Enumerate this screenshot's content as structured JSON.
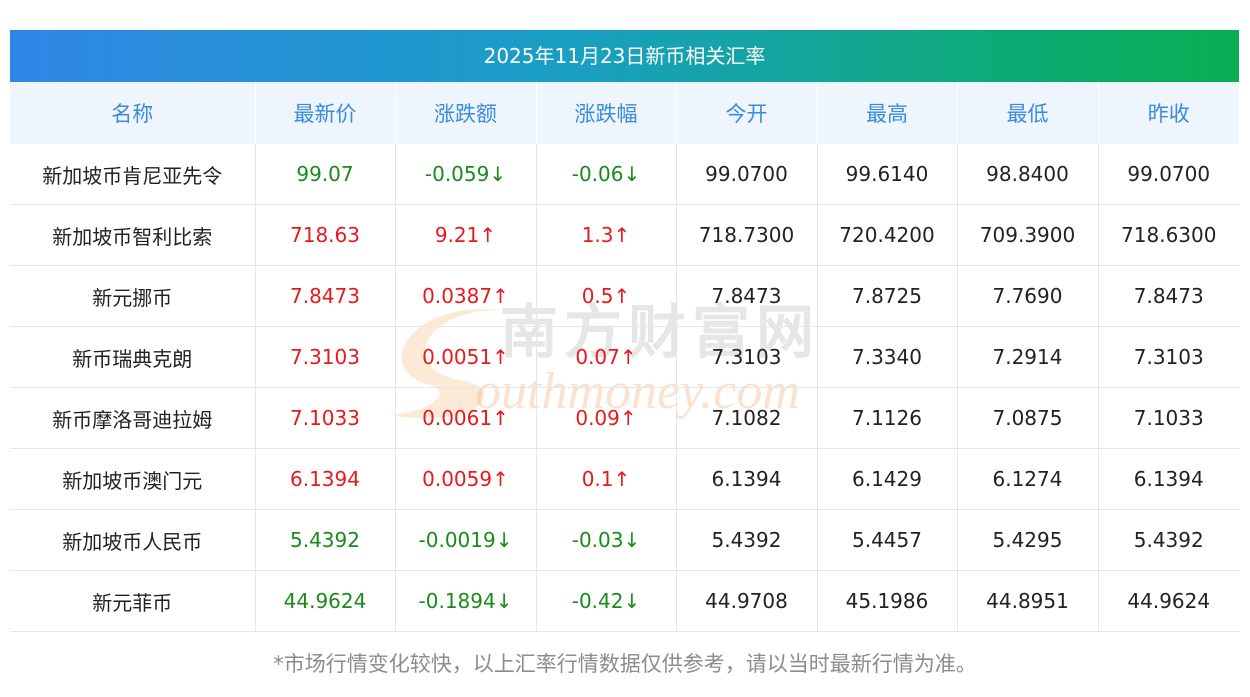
{
  "title": "2025年11月23日新币相关汇率",
  "columns": [
    "名称",
    "最新价",
    "涨跌额",
    "涨跌幅",
    "今开",
    "最高",
    "最低",
    "昨收"
  ],
  "rows": [
    {
      "name": "新加坡币肯尼亚先令",
      "latest": "99.07",
      "change": "-0.059↓",
      "change_pct": "-0.06↓",
      "open": "99.0700",
      "high": "99.6140",
      "low": "98.8400",
      "prev_close": "99.0700",
      "trend": "down"
    },
    {
      "name": "新加坡币智利比索",
      "latest": "718.63",
      "change": "9.21↑",
      "change_pct": "1.3↑",
      "open": "718.7300",
      "high": "720.4200",
      "low": "709.3900",
      "prev_close": "718.6300",
      "trend": "up"
    },
    {
      "name": "新元挪币",
      "latest": "7.8473",
      "change": "0.0387↑",
      "change_pct": "0.5↑",
      "open": "7.8473",
      "high": "7.8725",
      "low": "7.7690",
      "prev_close": "7.8473",
      "trend": "up"
    },
    {
      "name": "新币瑞典克朗",
      "latest": "7.3103",
      "change": "0.0051↑",
      "change_pct": "0.07↑",
      "open": "7.3103",
      "high": "7.3340",
      "low": "7.2914",
      "prev_close": "7.3103",
      "trend": "up"
    },
    {
      "name": "新币摩洛哥迪拉姆",
      "latest": "7.1033",
      "change": "0.0061↑",
      "change_pct": "0.09↑",
      "open": "7.1082",
      "high": "7.1126",
      "low": "7.0875",
      "prev_close": "7.1033",
      "trend": "up"
    },
    {
      "name": "新加坡币澳门元",
      "latest": "6.1394",
      "change": "0.0059↑",
      "change_pct": "0.1↑",
      "open": "6.1394",
      "high": "6.1429",
      "low": "6.1274",
      "prev_close": "6.1394",
      "trend": "up"
    },
    {
      "name": "新加坡币人民币",
      "latest": "5.4392",
      "change": "-0.0019↓",
      "change_pct": "-0.03↓",
      "open": "5.4392",
      "high": "5.4457",
      "low": "5.4295",
      "prev_close": "5.4392",
      "trend": "down"
    },
    {
      "name": "新元菲币",
      "latest": "44.9624",
      "change": "-0.1894↓",
      "change_pct": "-0.42↓",
      "open": "44.9708",
      "high": "45.1986",
      "low": "44.8951",
      "prev_close": "44.9624",
      "trend": "down"
    }
  ],
  "watermark": {
    "brand": "南方财富网",
    "domain": "outhmoney.com"
  },
  "footer_note": "*市场行情变化较快，以上汇率行情数据仅供参考，请以当时最新行情为准。",
  "colors": {
    "up": "#e8191c",
    "down": "#1b8a1b",
    "header_text": "#3a8be0",
    "header_bg": "#eef5fd"
  }
}
